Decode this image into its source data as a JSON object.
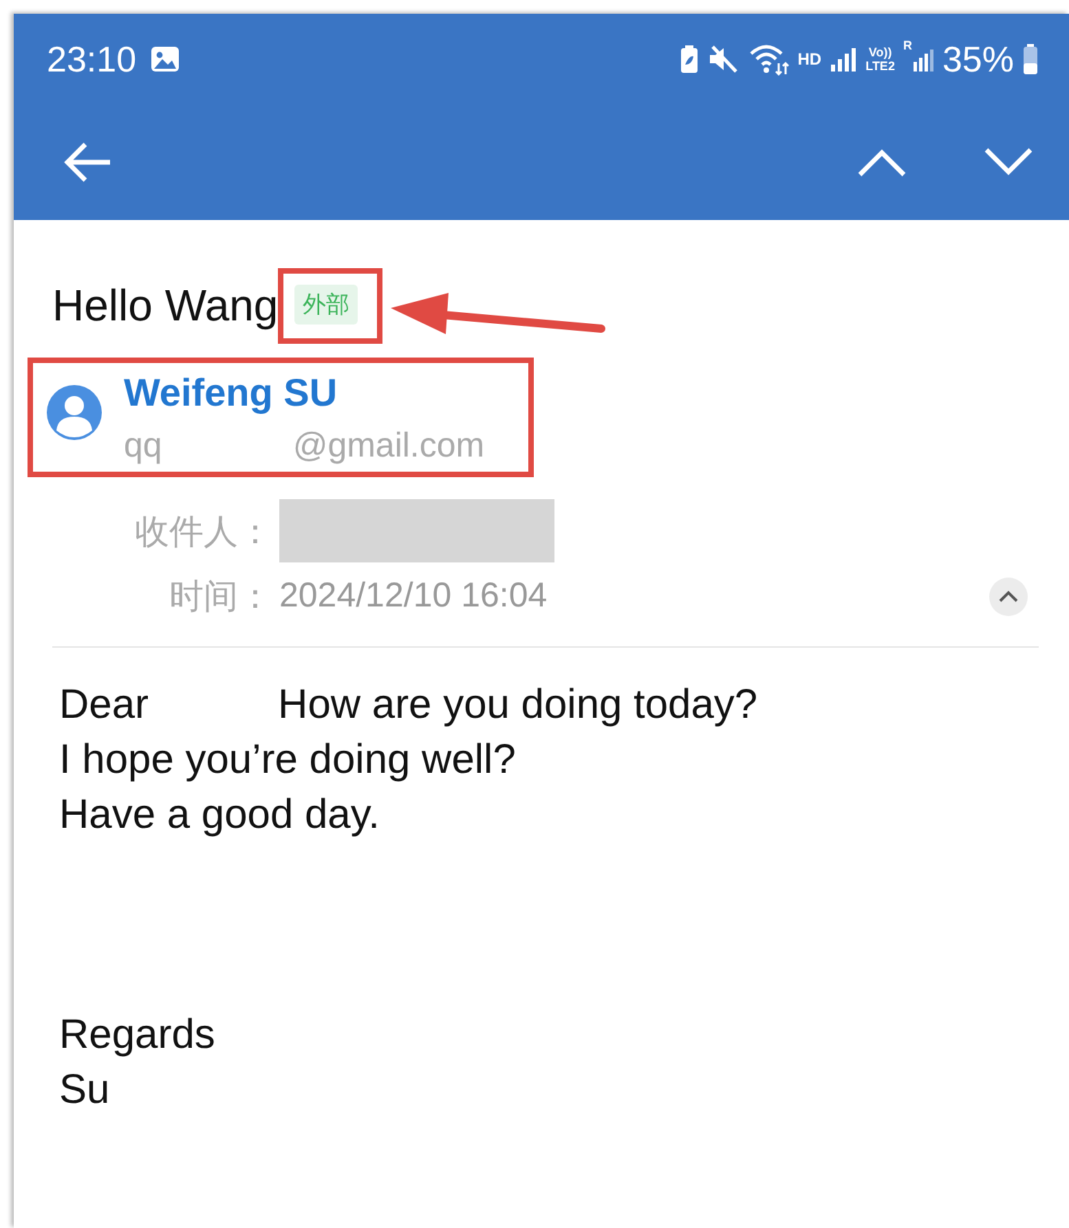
{
  "status_bar": {
    "time": "23:10",
    "network": [
      "HD",
      "Vo))",
      "LTE2",
      "R"
    ],
    "battery": "35%"
  },
  "toolbar": {
    "kind": "navigation"
  },
  "email": {
    "subject": "Hello Wang",
    "tag": "外部",
    "sender": {
      "name": "Weifeng SU",
      "address_start": "qq",
      "address_end": "@gmail.com"
    },
    "recipient_label": "收件人：",
    "time_label": "时间：",
    "time": "2024/12/10 16:04",
    "details_expanded": true,
    "body": [
      {
        "lines": [
          {
            "parts": [
              "Dear",
              "How are you doing today?"
            ]
          },
          {
            "parts": [
              "I hope you’re doing well?"
            ]
          },
          {
            "parts": [
              "Have a good day."
            ]
          }
        ]
      },
      {
        "lines": [
          {
            "parts": [
              "Regards"
            ]
          },
          {
            "parts": [
              "Su"
            ]
          }
        ]
      }
    ]
  },
  "annotations": {
    "highlight_tag": true,
    "highlight_sender": true,
    "arrow": true
  }
}
